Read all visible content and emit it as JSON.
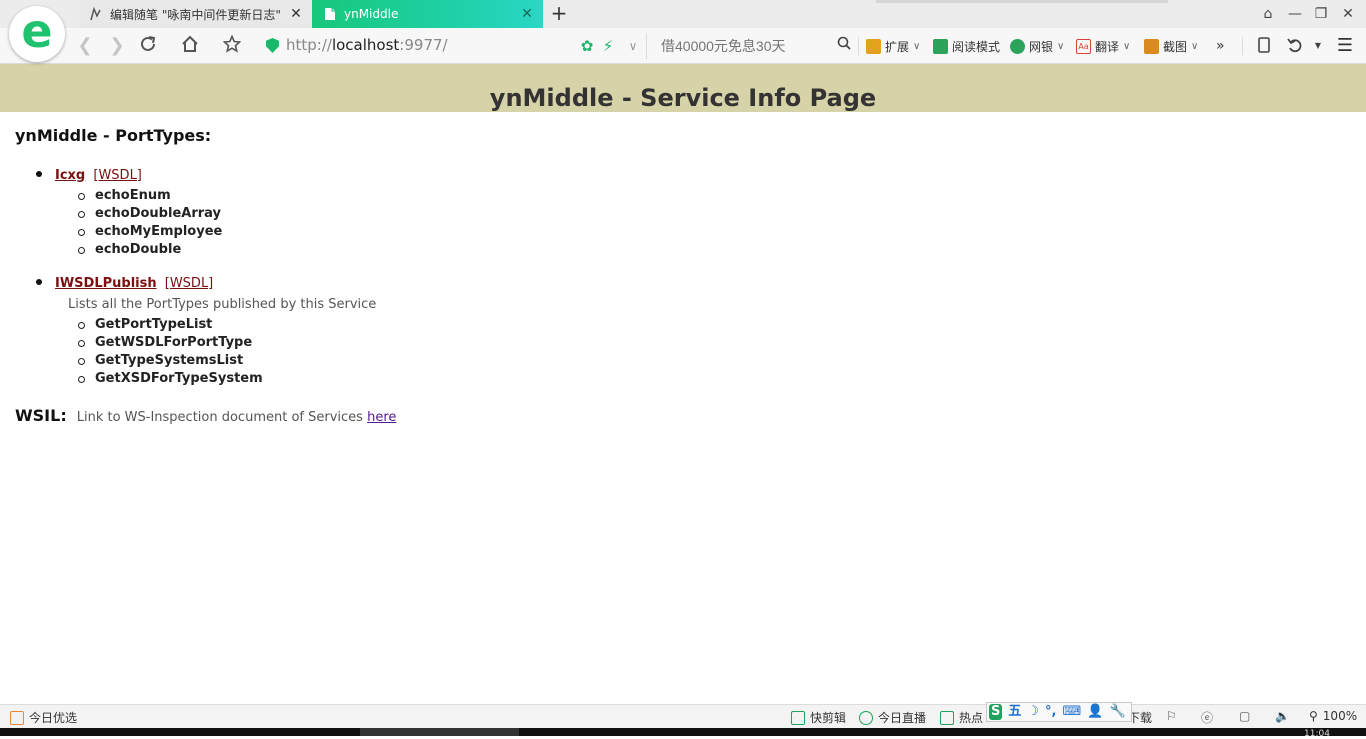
{
  "tabs": [
    {
      "title": "编辑随笔 \"咏南中间件更新日志\"",
      "active": false
    },
    {
      "title": "ynMiddle",
      "active": true
    }
  ],
  "new_tab_label": "+",
  "window_buttons": {
    "skin": "⌂",
    "minimize": "—",
    "restore": "❐",
    "close": "✕"
  },
  "toolbar": {
    "url_scheme": "http://",
    "url_host": "localhost",
    "url_rest": ":9977/",
    "search_placeholder": "借40000元免息30天",
    "tools": [
      {
        "label": "扩展",
        "icon": "extensions-icon",
        "color": "#e3a11e"
      },
      {
        "label": "阅读模式",
        "icon": "reading-mode-icon",
        "color": "#2ba35a"
      },
      {
        "label": "网银",
        "icon": "bank-shield-icon",
        "color": "#2ba35a"
      },
      {
        "label": "翻译",
        "icon": "translate-icon",
        "color": "#d9443a"
      },
      {
        "label": "截图",
        "icon": "screenshot-icon",
        "color": "#d98b1e"
      }
    ],
    "more_label": "»"
  },
  "page": {
    "banner_title": "ynMiddle - Service Info Page",
    "porttypes_title": "ynMiddle - PortTypes:",
    "ports": [
      {
        "name": "Icxg",
        "wsdl_label": "[WSDL]",
        "description": "",
        "methods": [
          "echoEnum",
          "echoDoubleArray",
          "echoMyEmployee",
          "echoDouble"
        ]
      },
      {
        "name": "IWSDLPublish",
        "wsdl_label": "[WSDL]",
        "description": "Lists all the PortTypes published by this Service",
        "methods": [
          "GetPortTypeList",
          "GetWSDLForPortType",
          "GetTypeSystemsList",
          "GetXSDForTypeSystem"
        ]
      }
    ],
    "wsil": {
      "label": "WSIL:",
      "text": "Link to WS-Inspection document of Services",
      "link_text": "here"
    }
  },
  "statusbar": {
    "left_label": "今日优选",
    "items": [
      "快剪辑",
      "今日直播",
      "热点",
      "下载"
    ],
    "zoom": "100%"
  },
  "ime": {
    "items": [
      "S",
      "五",
      "☽",
      "°,",
      "⌨",
      "👤",
      "🔧"
    ]
  },
  "clock": "11:04"
}
